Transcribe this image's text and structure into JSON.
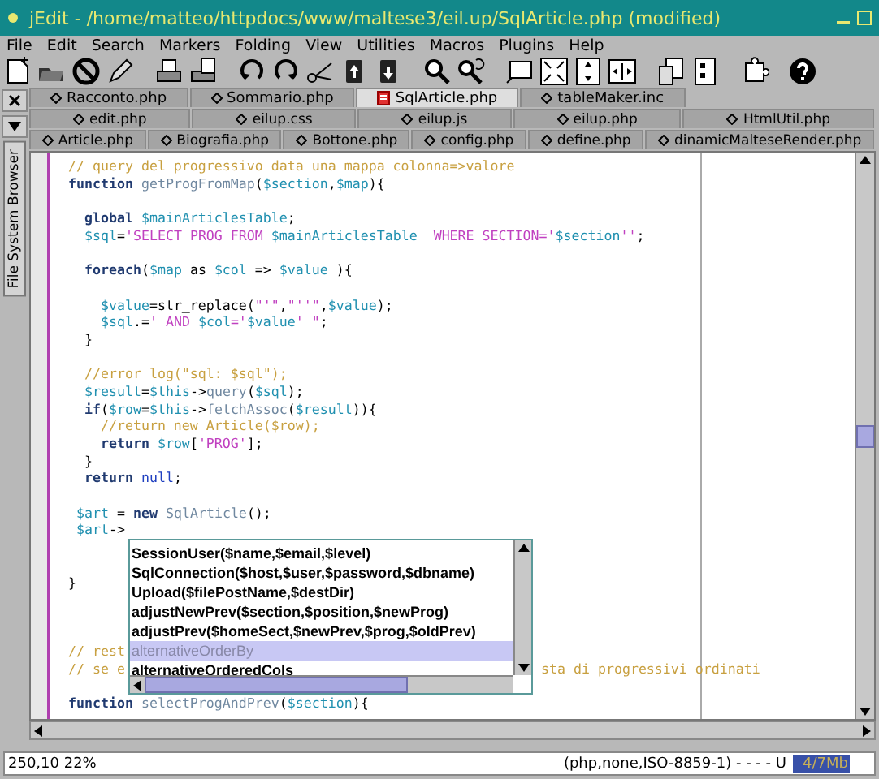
{
  "window": {
    "title": "jEdit - /home/matteo/httpdocs/www/maltese3/eil.up/SqlArticle.php (modified)"
  },
  "menu": [
    "File",
    "Edit",
    "Search",
    "Markers",
    "Folding",
    "View",
    "Utilities",
    "Macros",
    "Plugins",
    "Help"
  ],
  "side_panel": {
    "tab": "File System Browser"
  },
  "tab_rows": [
    [
      {
        "label": "Racconto.php",
        "selected": false
      },
      {
        "label": "Sommario.php",
        "selected": false
      },
      {
        "label": "SqlArticle.php",
        "selected": true
      },
      {
        "label": "tableMaker.inc",
        "selected": false
      }
    ],
    [
      {
        "label": "edit.php",
        "selected": false
      },
      {
        "label": "eilup.css",
        "selected": false
      },
      {
        "label": "eilup.js",
        "selected": false
      },
      {
        "label": "eilup.php",
        "selected": false
      },
      {
        "label": "HtmlUtil.php",
        "selected": false
      }
    ],
    [
      {
        "label": "Article.php",
        "selected": false
      },
      {
        "label": "Biografia.php",
        "selected": false
      },
      {
        "label": "Bottone.php",
        "selected": false
      },
      {
        "label": "config.php",
        "selected": false
      },
      {
        "label": "define.php",
        "selected": false
      },
      {
        "label": "dinamicMalteseRender.php",
        "selected": false
      }
    ]
  ],
  "editor": {
    "lines": [
      {
        "kind": "code",
        "tokens": [
          {
            "kind": "comment",
            "text": "// query del progressivo data una mappa colonna=>valore"
          }
        ]
      },
      {
        "kind": "code",
        "tokens": [
          {
            "kind": "keyword",
            "text": "function"
          },
          {
            "kind": "call",
            "text": " getProgFromMap"
          },
          {
            "kind": "plain",
            "text": "("
          },
          {
            "kind": "variable",
            "text": "$section"
          },
          {
            "kind": "plain",
            "text": ","
          },
          {
            "kind": "variable",
            "text": "$map"
          },
          {
            "kind": "plain",
            "text": "){"
          }
        ]
      },
      {
        "kind": "blank"
      },
      {
        "kind": "code",
        "tokens": [
          {
            "kind": "keyword",
            "text": "  global"
          },
          {
            "kind": "variable",
            "text": " $mainArticlesTable"
          },
          {
            "kind": "plain",
            "text": ";"
          }
        ]
      },
      {
        "kind": "code",
        "tokens": [
          {
            "kind": "variable",
            "text": "  $sql"
          },
          {
            "kind": "plain",
            "text": "="
          },
          {
            "kind": "string",
            "text": "'SELECT PROG FROM "
          },
          {
            "kind": "variable",
            "text": "$mainArticlesTable"
          },
          {
            "kind": "string",
            "text": "  WHERE SECTION='"
          },
          {
            "kind": "variable",
            "text": "$section"
          },
          {
            "kind": "string",
            "text": "''"
          },
          {
            "kind": "plain",
            "text": ";"
          }
        ]
      },
      {
        "kind": "blank"
      },
      {
        "kind": "code",
        "tokens": [
          {
            "kind": "keyword",
            "text": "  foreach"
          },
          {
            "kind": "plain",
            "text": "("
          },
          {
            "kind": "variable",
            "text": "$map"
          },
          {
            "kind": "plain",
            "text": " as "
          },
          {
            "kind": "variable",
            "text": "$col"
          },
          {
            "kind": "plain",
            "text": " => "
          },
          {
            "kind": "variable",
            "text": "$value"
          },
          {
            "kind": "plain",
            "text": " ){"
          }
        ]
      },
      {
        "kind": "blank"
      },
      {
        "kind": "code",
        "tokens": [
          {
            "kind": "variable",
            "text": "    $value"
          },
          {
            "kind": "plain",
            "text": "=str_replace("
          },
          {
            "kind": "string",
            "text": "\"'\""
          },
          {
            "kind": "plain",
            "text": ","
          },
          {
            "kind": "string",
            "text": "\"''\""
          },
          {
            "kind": "plain",
            "text": ","
          },
          {
            "kind": "variable",
            "text": "$value"
          },
          {
            "kind": "plain",
            "text": ");"
          }
        ]
      },
      {
        "kind": "code",
        "tokens": [
          {
            "kind": "variable",
            "text": "    $sql"
          },
          {
            "kind": "plain",
            "text": ".="
          },
          {
            "kind": "string",
            "text": "' AND "
          },
          {
            "kind": "variable",
            "text": "$col"
          },
          {
            "kind": "string",
            "text": "='"
          },
          {
            "kind": "variable",
            "text": "$value"
          },
          {
            "kind": "string",
            "text": "' \""
          },
          {
            "kind": "plain",
            "text": ";"
          }
        ]
      },
      {
        "kind": "code",
        "tokens": [
          {
            "kind": "plain",
            "text": "  }"
          }
        ]
      },
      {
        "kind": "blank"
      },
      {
        "kind": "code",
        "tokens": [
          {
            "kind": "comment",
            "text": "  //error_log(\"sql: $sql\");"
          }
        ]
      },
      {
        "kind": "code",
        "tokens": [
          {
            "kind": "variable",
            "text": "  $result"
          },
          {
            "kind": "plain",
            "text": "="
          },
          {
            "kind": "variable",
            "text": "$this"
          },
          {
            "kind": "plain",
            "text": "->"
          },
          {
            "kind": "call",
            "text": "query"
          },
          {
            "kind": "plain",
            "text": "("
          },
          {
            "kind": "variable",
            "text": "$sql"
          },
          {
            "kind": "plain",
            "text": ");"
          }
        ]
      },
      {
        "kind": "code",
        "tokens": [
          {
            "kind": "keyword",
            "text": "  if"
          },
          {
            "kind": "plain",
            "text": "("
          },
          {
            "kind": "variable",
            "text": "$row"
          },
          {
            "kind": "plain",
            "text": "="
          },
          {
            "kind": "variable",
            "text": "$this"
          },
          {
            "kind": "plain",
            "text": "->"
          },
          {
            "kind": "call",
            "text": "fetchAssoc"
          },
          {
            "kind": "plain",
            "text": "("
          },
          {
            "kind": "variable",
            "text": "$result"
          },
          {
            "kind": "plain",
            "text": ")){"
          }
        ]
      },
      {
        "kind": "code",
        "tokens": [
          {
            "kind": "comment",
            "text": "    //return new Article($row);"
          }
        ]
      },
      {
        "kind": "code",
        "tokens": [
          {
            "kind": "keyword",
            "text": "    return"
          },
          {
            "kind": "variable",
            "text": " $row"
          },
          {
            "kind": "plain",
            "text": "["
          },
          {
            "kind": "string",
            "text": "'PROG'"
          },
          {
            "kind": "plain",
            "text": "];"
          }
        ]
      },
      {
        "kind": "code",
        "tokens": [
          {
            "kind": "plain",
            "text": "  }"
          }
        ]
      },
      {
        "kind": "code",
        "tokens": [
          {
            "kind": "keyword",
            "text": "  return"
          },
          {
            "kind": "literal",
            "text": " null"
          },
          {
            "kind": "plain",
            "text": ";"
          }
        ]
      },
      {
        "kind": "blank"
      },
      {
        "kind": "code",
        "tokens": [
          {
            "kind": "variable",
            "text": " $art"
          },
          {
            "kind": "plain",
            "text": " = "
          },
          {
            "kind": "keyword",
            "text": "new"
          },
          {
            "kind": "call",
            "text": " SqlArticle"
          },
          {
            "kind": "plain",
            "text": "();"
          }
        ]
      },
      {
        "kind": "code",
        "tokens": [
          {
            "kind": "variable",
            "text": " $art"
          },
          {
            "kind": "plain",
            "text": "->"
          }
        ]
      },
      {
        "kind": "blank"
      },
      {
        "kind": "blank"
      },
      {
        "kind": "code",
        "tokens": [
          {
            "kind": "plain",
            "text": "}"
          }
        ]
      },
      {
        "kind": "blank"
      },
      {
        "kind": "blank"
      },
      {
        "kind": "blank"
      },
      {
        "kind": "code",
        "tokens": [
          {
            "kind": "comment",
            "text": "// rest"
          }
        ]
      },
      {
        "kind": "code",
        "tokens": [
          {
            "kind": "comment",
            "text": "// se e"
          }
        ],
        "tail": [
          {
            "kind": "comment",
            "text": "sta di progressivi ordinati"
          }
        ]
      },
      {
        "kind": "blank"
      },
      {
        "kind": "code",
        "tokens": [
          {
            "kind": "keyword",
            "text": "function"
          },
          {
            "kind": "call",
            "text": " selectProgAndPrev"
          },
          {
            "kind": "plain",
            "text": "("
          },
          {
            "kind": "variable",
            "text": "$section"
          },
          {
            "kind": "plain",
            "text": "){"
          }
        ]
      }
    ]
  },
  "completion_popup": {
    "items": [
      {
        "label": "SessionUser($name,$email,$level)",
        "selected": false
      },
      {
        "label": "SqlConnection($host,$user,$password,$dbname)",
        "selected": false
      },
      {
        "label": "Upload($filePostName,$destDir)",
        "selected": false
      },
      {
        "label": "adjustNewPrev($section,$position,$newProg)",
        "selected": false
      },
      {
        "label": "adjustPrev($homeSect,$newPrev,$prog,$oldPrev)",
        "selected": false
      },
      {
        "label": "alternativeOrderBy",
        "selected": true
      },
      {
        "label": "alternativeOrderedCols",
        "selected": false
      }
    ]
  },
  "status_bar": {
    "position": "250,10 22%",
    "mode": "(php,none,ISO-8859-1) - - - - U",
    "memory": {
      "label": "4/7Mb",
      "level": 0.72
    }
  }
}
